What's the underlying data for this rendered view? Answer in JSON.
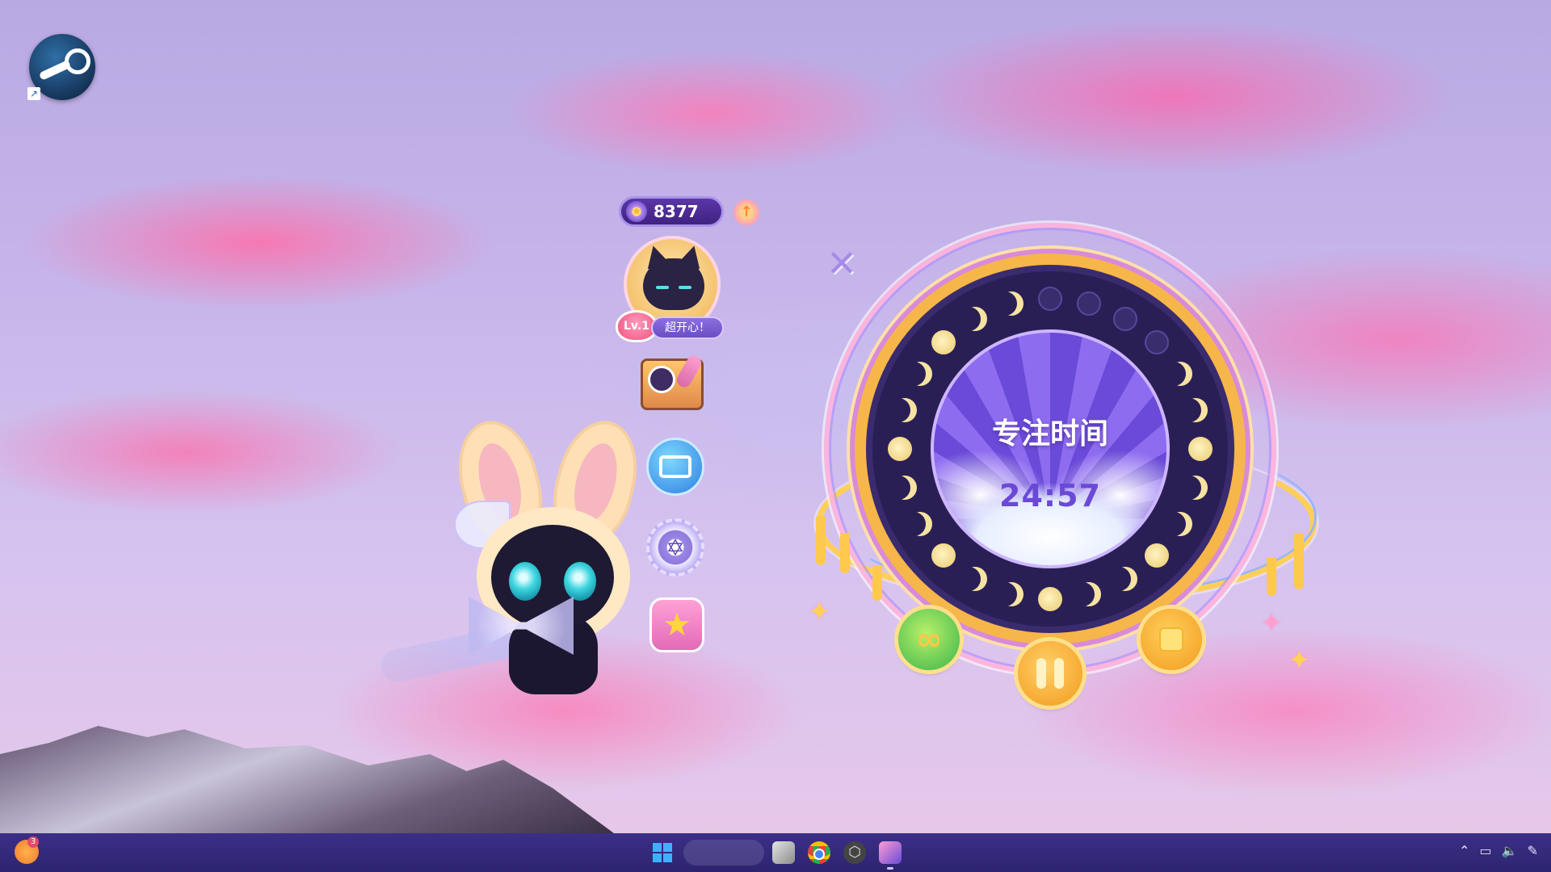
{
  "desktop": {
    "icons": [
      {
        "name": "steam",
        "icon": "steam-icon",
        "shortcut_icon": "shortcut-arrow-icon"
      }
    ]
  },
  "pet_panel": {
    "coins": "8377",
    "level": "Lv.1",
    "mood": "超开心！",
    "menu_buttons": [
      "journal-icon",
      "screen-icon",
      "gear-icon",
      "star-icon"
    ]
  },
  "timer": {
    "title": "专注时间",
    "time": "24:57",
    "controls": [
      "loop-icon",
      "pause-icon",
      "stop-icon"
    ],
    "close_icon": "close-icon"
  },
  "taskbar": {
    "notification_badge": "3",
    "tray_icons": [
      "chevron-up-icon",
      "network-icon",
      "volume-icon",
      "input-icon"
    ]
  },
  "colors": {
    "accent_purple": "#6b49d6",
    "ring_gold": "#f6b64a",
    "taskbar": "#2d2470"
  }
}
